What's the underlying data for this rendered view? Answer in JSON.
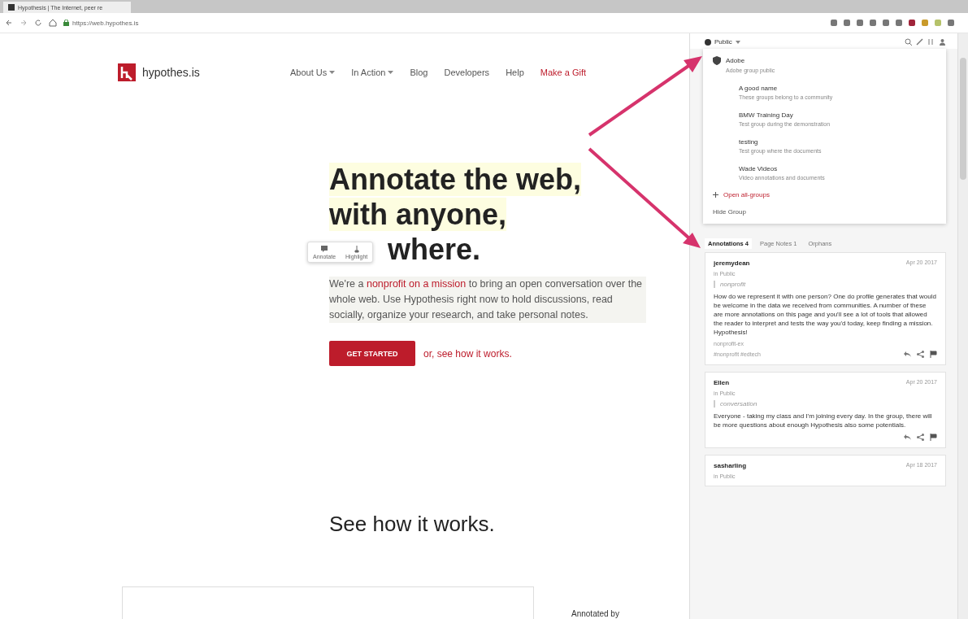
{
  "browser": {
    "tab_title": "Hypothesis | The Internet, peer re",
    "address": "https://web.hypothes.is"
  },
  "site": {
    "logo_text": "hypothes.is",
    "nav": [
      {
        "label": "About Us",
        "kind": "menu"
      },
      {
        "label": "In Action",
        "kind": "menu"
      },
      {
        "label": "Blog",
        "kind": "link"
      },
      {
        "label": "Developers",
        "kind": "link"
      },
      {
        "label": "Help",
        "kind": "link"
      },
      {
        "label": "Make a Gift",
        "kind": "accent"
      }
    ],
    "headline": [
      "Annotate the web,",
      "with anyone,",
      "where."
    ],
    "intro": "We're a *nonprofit on a mission* to bring an open conversation over the whole web. Use Hypothesis right now to hold discussions, read socially, organize your research, and take personal notes.",
    "cta": "GET STARTED",
    "cta_after": "or, see how it works.",
    "adder": [
      {
        "label": "Annotate",
        "kind": "annotate"
      },
      {
        "label": "Highlight",
        "kind": "highlight"
      }
    ],
    "section_title": "See how it works.",
    "footer_snippet": "Annotated by"
  },
  "sidebar": {
    "group": "Public",
    "groups": [
      {
        "name": "Adobe",
        "description": "Adobe group public",
        "selected": true
      },
      {
        "name": "A good name",
        "description": "These groups belong to a community",
        "selected": false
      },
      {
        "name": "BMW Training Day",
        "description": "Test group during the demonstration",
        "selected": false
      },
      {
        "name": "testing",
        "description": "Test group where the documents",
        "selected": false
      },
      {
        "name": "Wade Videos",
        "description": "Video annotations and documents",
        "selected": false
      }
    ],
    "group_actions": [
      {
        "label": "Open all-groups",
        "kind": "new"
      },
      {
        "label": "Hide Group",
        "kind": "plain"
      }
    ],
    "tabs": [
      {
        "label": "Annotations 4",
        "selected": true
      },
      {
        "label": "Page Notes 1",
        "selected": false
      },
      {
        "label": "Orphans",
        "selected": false
      }
    ],
    "annotations": [
      {
        "user": "jeremydean",
        "group": "in Public",
        "date": "Apr 20 2017",
        "quote": "nonprofit",
        "body": "How do we represent it with one person? One do profile generates that would be welcome in the data we received from communities. A number of these are more annotations on this page and you'll see a lot of tools that allowed the reader to interpret and tests the way you'd today, keep finding a mission. Hypothesis!",
        "tags": "nonprofit-ex",
        "footer": "#nonprofit #edtech"
      },
      {
        "user": "Ellen",
        "group": "in Public",
        "date": "Apr 20 2017",
        "quote": "conversation",
        "body": "Everyone - taking my class and I'm joining every day. In the group, there will be more questions about enough Hypothesis also some potentials."
      },
      {
        "user": "sasharling",
        "group": "in Public",
        "date": "Apr 18 2017"
      }
    ]
  }
}
